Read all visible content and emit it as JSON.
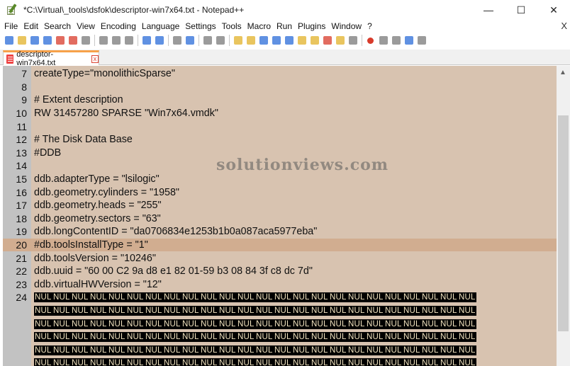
{
  "window": {
    "title": "*C:\\Virtual\\_tools\\dsfok\\descriptor-win7x64.txt - Notepad++",
    "minimize": "—",
    "maximize": "☐",
    "close": "✕"
  },
  "menu": {
    "items": [
      "File",
      "Edit",
      "Search",
      "View",
      "Encoding",
      "Language",
      "Settings",
      "Tools",
      "Macro",
      "Run",
      "Plugins",
      "Window",
      "?"
    ],
    "close_glyph": "X"
  },
  "toolbar": {
    "icons": [
      "new-file-icon",
      "open-file-icon",
      "save-icon",
      "save-all-icon",
      "close-icon",
      "close-all-icon",
      "print-icon",
      "cut-icon",
      "copy-icon",
      "paste-icon",
      "undo-icon",
      "redo-icon",
      "find-icon",
      "replace-icon",
      "zoom-in-icon",
      "zoom-out-icon",
      "sync-vertical-icon",
      "sync-horizontal-icon",
      "word-wrap-icon",
      "show-all-chars-icon",
      "indent-guide-icon",
      "language-icon",
      "doc-map-icon",
      "function-list-icon",
      "folder-icon",
      "monitor-icon",
      "record-macro-icon",
      "stop-macro-icon",
      "play-macro-icon",
      "run-multiple-icon",
      "save-macro-icon"
    ],
    "colors": {
      "red": "#d83b2b",
      "blue": "#2b6cd8",
      "green": "#3a9a3a",
      "yellow": "#e2b12a",
      "gray": "#7a7a7a"
    }
  },
  "tab": {
    "label": "descriptor-win7x64.txt",
    "close_glyph": "x"
  },
  "editor": {
    "background": "#d8c3b0",
    "current_line_color": "#d1ad90",
    "lines": [
      {
        "n": "7",
        "text": "createType=\"monolithicSparse\""
      },
      {
        "n": "8",
        "text": ""
      },
      {
        "n": "9",
        "text": "# Extent description"
      },
      {
        "n": "10",
        "text": "RW 31457280 SPARSE \"Win7x64.vmdk\""
      },
      {
        "n": "11",
        "text": ""
      },
      {
        "n": "12",
        "text": "# The Disk Data Base"
      },
      {
        "n": "13",
        "text": "#DDB"
      },
      {
        "n": "14",
        "text": ""
      },
      {
        "n": "15",
        "text": "ddb.adapterType = \"lsilogic\""
      },
      {
        "n": "16",
        "text": "ddb.geometry.cylinders = \"1958\""
      },
      {
        "n": "17",
        "text": "ddb.geometry.heads = \"255\""
      },
      {
        "n": "18",
        "text": "ddb.geometry.sectors = \"63\""
      },
      {
        "n": "19",
        "text": "ddb.longContentID = \"da0706834e1253b1b0a087aca5977eba\""
      },
      {
        "n": "20",
        "text": "#db.toolsInstallType = \"1\""
      },
      {
        "n": "21",
        "text": "ddb.toolsVersion = \"10246\""
      },
      {
        "n": "22",
        "text": "ddb.uuid = \"60 00 C2 9a d8 e1 82 01-59 b3 08 84 3f c8 dc 7d\""
      },
      {
        "n": "23",
        "text": "ddb.virtualHWVersion = \"12\""
      }
    ],
    "nul_line_number": "24",
    "nul_token": "NUL",
    "nul_rows": 6,
    "nul_per_row": 24
  },
  "watermark": "solutionviews.com"
}
